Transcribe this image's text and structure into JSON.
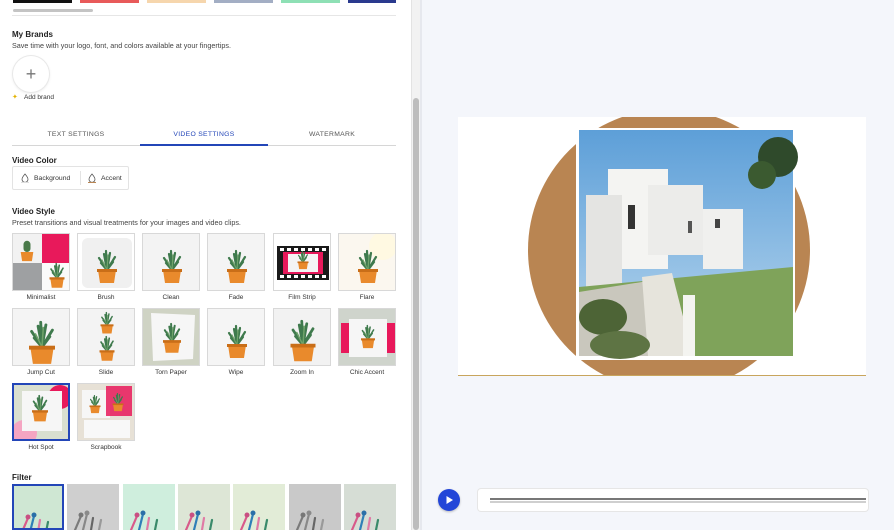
{
  "brand_colors": [
    "#111111",
    "#e85a5a",
    "#f6d6ad",
    "#a3aec4",
    "#8ee0b5",
    "#2a3a8e"
  ],
  "my_brands": {
    "title": "My Brands",
    "subtitle": "Save time with your logo, font, and colors available at your fingertips.",
    "add_label": "Add brand",
    "add_icon": "plus-icon"
  },
  "tabs": [
    {
      "label": "TEXT SETTINGS",
      "active": false
    },
    {
      "label": "VIDEO SETTINGS",
      "active": true
    },
    {
      "label": "WATERMARK",
      "active": false
    }
  ],
  "video_color": {
    "title": "Video Color",
    "chips": [
      {
        "label": "Background",
        "color": "#ffffff"
      },
      {
        "label": "Accent",
        "color": "#b98552"
      }
    ]
  },
  "video_style": {
    "title": "Video Style",
    "subtitle": "Preset transitions and visual treatments for your images and video clips.",
    "styles": [
      "Minimalist",
      "Brush",
      "Clean",
      "Fade",
      "Film Strip",
      "Flare",
      "Jump Cut",
      "Slide",
      "Torn Paper",
      "Wipe",
      "Zoom In",
      "Chic Accent",
      "Hot Spot",
      "Scrapbook"
    ],
    "selected": "Hot Spot"
  },
  "filter": {
    "title": "Filter"
  },
  "preview": {
    "accent_color": "#b98552",
    "play_icon": "play-icon"
  }
}
